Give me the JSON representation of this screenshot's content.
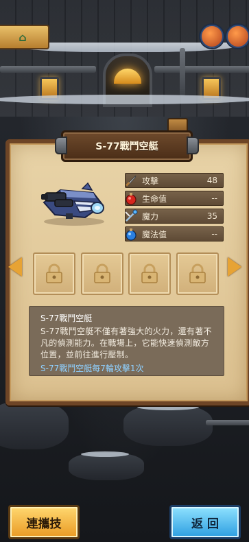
{
  "item": {
    "title": "S-77戰鬥空艇",
    "name": "S-77戰鬥空艇",
    "description": "S-77戰鬥空艇不僅有著強大的火力，還有著不凡的偵測能力。在戰場上，它能快速偵測敵方位置，並前往進行壓制。",
    "effect": "S-77戰鬥空艇每7輪攻擊1次"
  },
  "stats": [
    {
      "label": "攻擊",
      "value": "48",
      "icon": "sword-icon"
    },
    {
      "label": "生命值",
      "value": "--",
      "icon": "health-potion-icon"
    },
    {
      "label": "魔力",
      "value": "35",
      "icon": "magic-staff-icon"
    },
    {
      "label": "魔法值",
      "value": "--",
      "icon": "mana-potion-icon"
    }
  ],
  "slots": [
    {
      "state": "locked",
      "icon": "padlock-icon"
    },
    {
      "state": "locked",
      "icon": "padlock-icon"
    },
    {
      "state": "locked",
      "icon": "padlock-icon"
    },
    {
      "state": "locked",
      "icon": "padlock-icon"
    }
  ],
  "buttons": {
    "combo": "連攜技",
    "back": "返 回"
  },
  "colors": {
    "panel": "#e1c896",
    "panel_border": "#6e4526",
    "effect_text": "#8fd0ff",
    "combo_button": "#f2b13c",
    "back_button": "#4ab4ea"
  }
}
